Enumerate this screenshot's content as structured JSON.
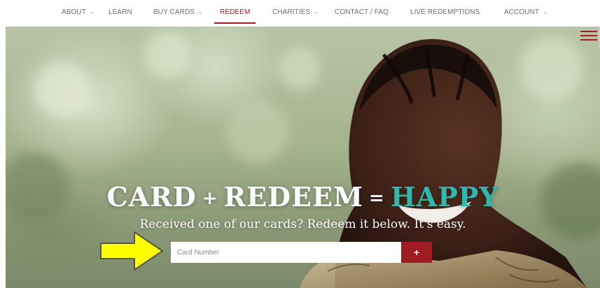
{
  "nav": {
    "items": [
      {
        "label": "ABOUT",
        "dropdown": true
      },
      {
        "label": "LEARN",
        "dropdown": false
      },
      {
        "label": "BUY CARDS",
        "dropdown": true
      },
      {
        "label": "REDEEM",
        "dropdown": false,
        "active": true
      },
      {
        "label": "CHARITIES",
        "dropdown": true
      },
      {
        "label": "CONTACT / FAQ",
        "dropdown": false
      },
      {
        "label": "LIVE REDEMPTIONS",
        "dropdown": false
      },
      {
        "label": "ACCOUNT",
        "dropdown": true
      }
    ],
    "caret": "⌄"
  },
  "hero": {
    "headline_part1": "CARD",
    "headline_plus": "+",
    "headline_part2": "REDEEM",
    "headline_equals": "=",
    "headline_accent": "HAPPY",
    "subheadline": "Received one of our cards? Redeem it below. It's easy.",
    "card_input": {
      "value": "",
      "placeholder": "Card Number"
    },
    "submit_label": "+"
  },
  "colors": {
    "brand": "#a41c24",
    "accent": "#2fb8ad",
    "annotation_arrow": "#ffff00"
  },
  "icons": {
    "menu": "hamburger-menu-icon",
    "annotation": "arrow-right-icon"
  }
}
